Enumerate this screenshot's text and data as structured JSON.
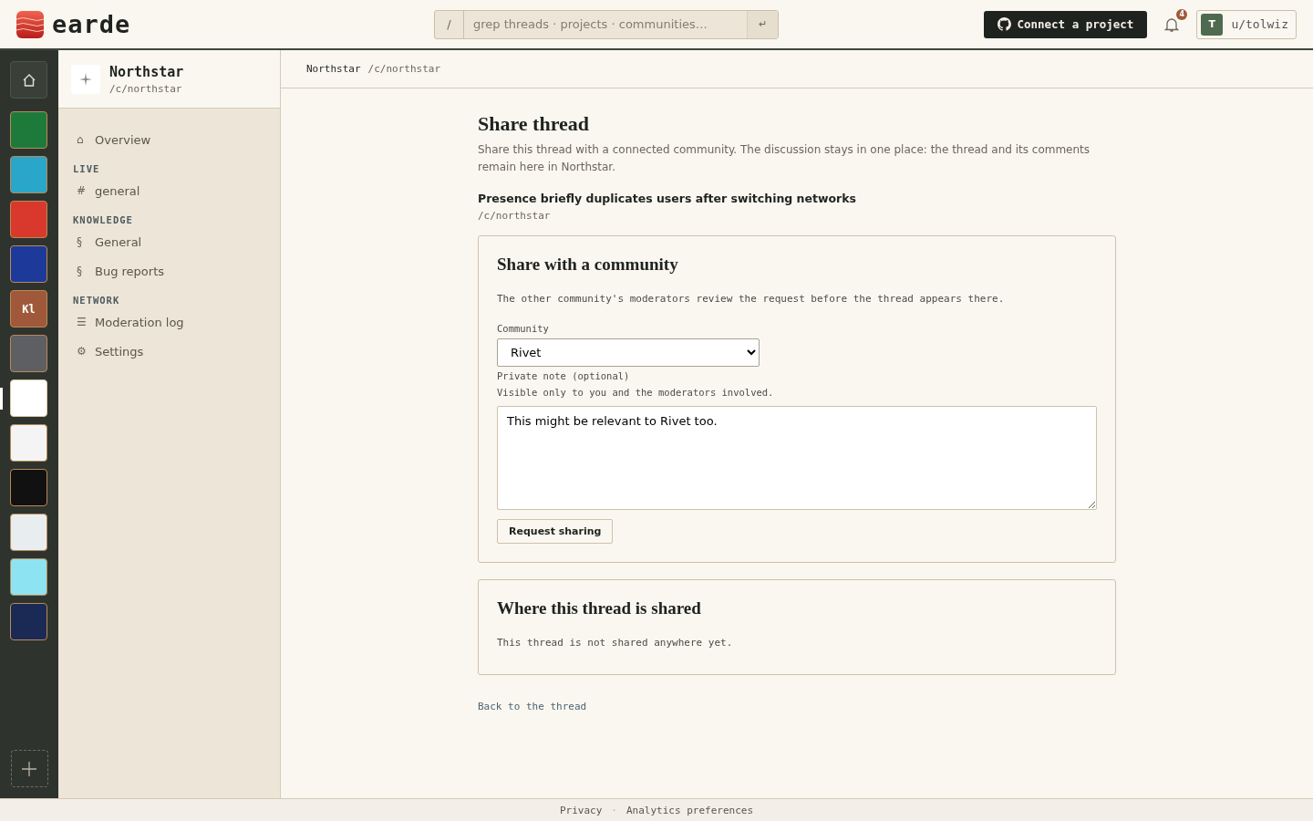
{
  "header": {
    "brand": "earde",
    "search": {
      "prefix": "/",
      "placeholder": "grep threads · projects · communities…",
      "submit": "↵"
    },
    "connect_button": "Connect a project",
    "notifications": {
      "count": "4"
    },
    "user": {
      "initial": "T",
      "name": "u/tolwiz"
    }
  },
  "rail": {
    "items": [
      {
        "kind": "home",
        "selected": false
      },
      {
        "kind": "image",
        "selected": false,
        "color": "#1e7a3a"
      },
      {
        "kind": "image",
        "selected": false,
        "color": "#29a6c9"
      },
      {
        "kind": "image",
        "selected": false,
        "color": "#d9392c"
      },
      {
        "kind": "image",
        "selected": false,
        "color": "#1d3a9a"
      },
      {
        "kind": "initials",
        "label": "Kl",
        "selected": false,
        "color": "#a0583a"
      },
      {
        "kind": "image",
        "selected": false,
        "color": "#5d5f63"
      },
      {
        "kind": "image",
        "selected": true,
        "color": "#ffffff"
      },
      {
        "kind": "image",
        "selected": false,
        "color": "#f4f4f4"
      },
      {
        "kind": "image",
        "selected": false,
        "color": "#111111"
      },
      {
        "kind": "image",
        "selected": false,
        "color": "#e8eef0"
      },
      {
        "kind": "image",
        "selected": false,
        "color": "#8ee3f2"
      },
      {
        "kind": "image",
        "selected": false,
        "color": "#1b2a55"
      }
    ]
  },
  "sidebar": {
    "community": {
      "name": "Northstar",
      "path": "/c/northstar"
    },
    "nav": [
      {
        "kind": "link",
        "icon": "⌂",
        "label": "Overview"
      },
      {
        "kind": "heading",
        "label": "LIVE"
      },
      {
        "kind": "link",
        "icon": "#",
        "label": "general"
      },
      {
        "kind": "heading",
        "label": "KNOWLEDGE"
      },
      {
        "kind": "link",
        "icon": "§",
        "label": "General"
      },
      {
        "kind": "link",
        "icon": "§",
        "label": "Bug reports"
      },
      {
        "kind": "heading",
        "label": "NETWORK"
      },
      {
        "kind": "link",
        "icon": "☰",
        "label": "Moderation log"
      },
      {
        "kind": "link",
        "icon": "⚙",
        "label": "Settings"
      }
    ]
  },
  "breadcrumb": {
    "community": "Northstar",
    "path": "/c/northstar"
  },
  "page": {
    "title": "Share thread",
    "intro": "Share this thread with a connected community. The discussion stays in one place: the thread and its comments remain here in Northstar.",
    "thread_title": "Presence briefly duplicates users after switching networks",
    "thread_path": "/c/northstar",
    "share_card": {
      "title": "Share with a community",
      "description": "The other community's moderators review the request before the thread appears there.",
      "community_label": "Community",
      "community_value": "Rivet",
      "note_label": "Private note (optional)",
      "note_hint": "Visible only to you and the moderators involved.",
      "note_value": "This might be relevant to Rivet too.",
      "button": "Request sharing"
    },
    "shared_card": {
      "title": "Where this thread is shared",
      "empty": "This thread is not shared anywhere yet."
    },
    "back_link": "Back to the thread"
  },
  "footer": {
    "links": [
      "Privacy",
      "Analytics preferences"
    ],
    "separator": "·"
  }
}
